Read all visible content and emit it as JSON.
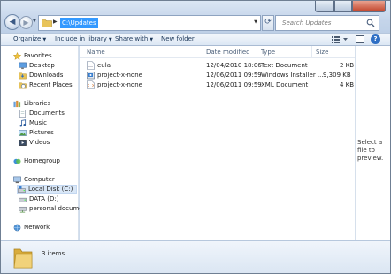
{
  "address": {
    "path": "C:\\Updates"
  },
  "search": {
    "placeholder": "Search Updates"
  },
  "toolbar": {
    "organize": "Organize",
    "include_in_library": "Include in library",
    "share_with": "Share with",
    "new_folder": "New folder",
    "help": "?"
  },
  "nav": {
    "favorites": "Favorites",
    "desktop": "Desktop",
    "downloads": "Downloads",
    "recent_places": "Recent Places",
    "libraries": "Libraries",
    "documents": "Documents",
    "music": "Music",
    "pictures": "Pictures",
    "videos": "Videos",
    "homegroup": "Homegroup",
    "computer": "Computer",
    "local_disk": "Local Disk (C:)",
    "data_drive": "DATA (D:)",
    "personal_documents": "personal documents",
    "network": "Network"
  },
  "columns": {
    "name": "Name",
    "date_modified": "Date modified",
    "type": "Type",
    "size": "Size"
  },
  "files": [
    {
      "name": "eula",
      "date": "12/04/2010 18:06",
      "type": "Text Document",
      "size": "2 KB",
      "icon": "text-file-icon"
    },
    {
      "name": "project-x-none",
      "date": "12/06/2011 09:59",
      "type": "Windows Installer ...",
      "size": "9,309 KB",
      "icon": "installer-file-icon"
    },
    {
      "name": "project-x-none",
      "date": "12/06/2011 09:59",
      "type": "XML Document",
      "size": "4 KB",
      "icon": "xml-file-icon"
    }
  ],
  "preview": {
    "message": "Select a file to preview."
  },
  "details": {
    "item_count": "3 items"
  },
  "colors": {
    "selection": "#3399ff",
    "frame": "#cfdcec",
    "close_button": "#c2452c"
  }
}
